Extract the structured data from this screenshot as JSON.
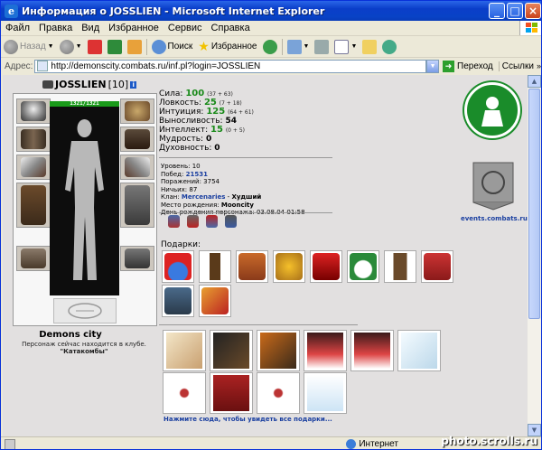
{
  "window": {
    "title": "Информация о JOSSLIEN - Microsoft Internet Explorer",
    "buttons": [
      "_",
      "□",
      "×"
    ]
  },
  "menu": [
    "Файл",
    "Правка",
    "Вид",
    "Избранное",
    "Сервис",
    "Справка"
  ],
  "toolbar": {
    "back": "Назад",
    "search": "Поиск",
    "favorites": "Избранное"
  },
  "address": {
    "label": "Адрес:",
    "url": "http://demonscity.combats.ru/inf.pl?login=JOSSLIEN",
    "go": "Переход",
    "links": "Ссылки"
  },
  "character": {
    "name": "JOSSLIEN",
    "level": "[10]",
    "hp": "1321/1321",
    "city": "Demons city",
    "location_text": "Персонаж сейчас находится в клубе.",
    "location_room": "\"Катакомбы\""
  },
  "stats": [
    {
      "label": "Сила:",
      "value": "100",
      "bonus": "(37 + 63)",
      "highlight": true
    },
    {
      "label": "Ловкость:",
      "value": "25",
      "bonus": "(7 + 18)",
      "highlight": true
    },
    {
      "label": "Интуиция:",
      "value": "125",
      "bonus": "(64 + 61)",
      "highlight": true
    },
    {
      "label": "Выносливость:",
      "value": "54",
      "bonus": "",
      "highlight": false
    },
    {
      "label": "Интеллект:",
      "value": "15",
      "bonus": "(0 + 5)",
      "highlight": true
    },
    {
      "label": "Мудрость:",
      "value": "0",
      "bonus": "",
      "highlight": false
    },
    {
      "label": "Духовность:",
      "value": "0",
      "bonus": "",
      "highlight": false
    }
  ],
  "details": {
    "level_label": "Уровень:",
    "level": "10",
    "wins_label": "Побед:",
    "wins": "21531",
    "losses_label": "Поражений:",
    "losses": "3754",
    "draws_label": "Ничьих:",
    "draws": "87",
    "clan_label": "Клан:",
    "clan": "Mercenaries",
    "clan_sep": " - ",
    "clan_rank": "Худший",
    "birthplace_label": "Место рождения:",
    "birthplace": "Mooncity",
    "birthday_label": "День рождения персонажа:",
    "birthday": "03.08.04 01:58"
  },
  "gifts": {
    "title": "Подарки:",
    "link": "Нажмите сюда, чтобы увидеть все подарки..."
  },
  "events_link": "events.combats.ru",
  "status": {
    "zone": "Интернет"
  },
  "watermark": "photo.scrolls.ru"
}
